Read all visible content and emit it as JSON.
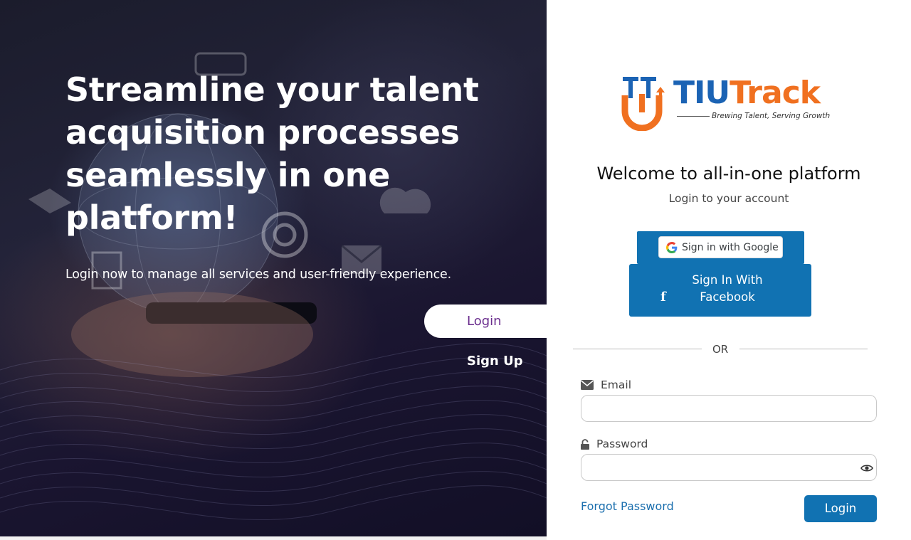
{
  "hero": {
    "title": "Streamline your talent acquisition processes seamlessly in one platform!",
    "subtitle": "Login now to manage all services and user-friendly experience.",
    "tab_login": "Login",
    "tab_signup": "Sign Up"
  },
  "brand": {
    "name_part1": "TIU",
    "name_part2": "Track",
    "tagline": "Brewing Talent, Serving Growth",
    "colors": {
      "blue": "#1b63b4",
      "orange": "#f07020",
      "button": "#1172b2"
    }
  },
  "panel": {
    "welcome": "Welcome to all-in-one platform",
    "subtitle": "Login to your account",
    "google_label": "Sign in with Google",
    "facebook_label": "Sign In With\nFacebook",
    "or_text": "OR",
    "email_label": "Email",
    "email_value": "",
    "password_label": "Password",
    "password_value": "",
    "forgot_label": "Forgot Password",
    "login_label": "Login"
  },
  "icons": {
    "email": "envelope-icon",
    "password": "lock-icon",
    "show_password": "eye-icon",
    "facebook": "facebook-icon",
    "google": "google-g-icon"
  }
}
